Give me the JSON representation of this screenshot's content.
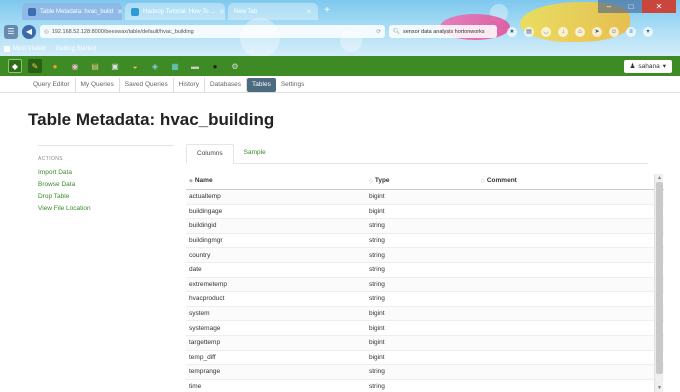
{
  "browser": {
    "tabs": [
      {
        "title": "Table Metadata: hvac_build",
        "active": true
      },
      {
        "title": "Hadoop Tutorial: How To ...",
        "active": false
      },
      {
        "title": "New Tab",
        "active": false
      }
    ],
    "url": "192.168.52.128:8000/beeswax/table/default/hvac_building",
    "search_value": "sensor data analysis hortonworks",
    "bookmarks": [
      "Most Visited",
      "Getting Started"
    ],
    "window_controls": {
      "minimize": "–",
      "maximize": "□",
      "close": "✕"
    }
  },
  "appbar": {
    "user": "sahana",
    "icons": [
      "hue-logo-icon",
      "query-icon",
      "beeswax-icon",
      "pig-icon",
      "file-browser-icon",
      "job-designer-icon",
      "oozie-icon",
      "hbase-icon",
      "table-icon",
      "shell-icon",
      "help-icon"
    ]
  },
  "subnav": {
    "items": [
      "Query Editor",
      "My Queries",
      "Saved Queries",
      "History",
      "Databases",
      "Tables",
      "Settings"
    ],
    "active": "Tables"
  },
  "page": {
    "title": "Table Metadata: hvac_building"
  },
  "actions": {
    "heading": "ACTIONS",
    "links": [
      "Import Data",
      "Browse Data",
      "Drop Table",
      "View File Location"
    ]
  },
  "content_tabs": [
    "Columns",
    "Sample"
  ],
  "table": {
    "headers": [
      "Name",
      "Type",
      "Comment"
    ],
    "rows": [
      {
        "name": "actualtemp",
        "type": "bigint",
        "comment": ""
      },
      {
        "name": "buildingage",
        "type": "bigint",
        "comment": ""
      },
      {
        "name": "buildingid",
        "type": "string",
        "comment": ""
      },
      {
        "name": "buildingmgr",
        "type": "string",
        "comment": ""
      },
      {
        "name": "country",
        "type": "string",
        "comment": ""
      },
      {
        "name": "date",
        "type": "string",
        "comment": ""
      },
      {
        "name": "extremetemp",
        "type": "string",
        "comment": ""
      },
      {
        "name": "hvacproduct",
        "type": "string",
        "comment": ""
      },
      {
        "name": "system",
        "type": "bigint",
        "comment": ""
      },
      {
        "name": "systemage",
        "type": "bigint",
        "comment": ""
      },
      {
        "name": "targettemp",
        "type": "bigint",
        "comment": ""
      },
      {
        "name": "temp_diff",
        "type": "bigint",
        "comment": ""
      },
      {
        "name": "temprange",
        "type": "string",
        "comment": ""
      },
      {
        "name": "time",
        "type": "string",
        "comment": ""
      }
    ]
  },
  "colors": {
    "appbar_green": "#3e8b25",
    "link_green": "#3a8b2a",
    "active_tab": "#4c6a80"
  }
}
